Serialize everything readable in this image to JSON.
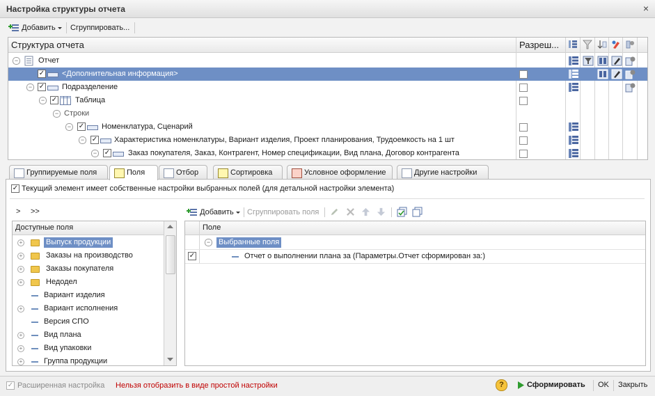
{
  "window": {
    "title": "Настройка структуры отчета",
    "close_glyph": "×"
  },
  "toolbar": {
    "add_label": "Добавить",
    "group_label": "Сгруппировать..."
  },
  "tree": {
    "col_structure": "Структура отчета",
    "col_allowed": "Разреш...",
    "rows": [
      {
        "label": "Отчет"
      },
      {
        "label": "<Дополнительная информация>"
      },
      {
        "label": "Подразделение"
      },
      {
        "label": "Таблица"
      },
      {
        "label": "Строки"
      },
      {
        "label": "Номенклатура, Сценарий"
      },
      {
        "label": "Характеристика номенклатуры, Вариант изделия, Проект планирования, Трудоемкость на 1 шт"
      },
      {
        "label": "Заказ покупателя, Заказ, Контрагент, Номер спецификации, Вид плана, Договор контрагента"
      }
    ]
  },
  "tabs": [
    {
      "label": "Группируемые поля"
    },
    {
      "label": "Поля"
    },
    {
      "label": "Отбор"
    },
    {
      "label": "Сортировка"
    },
    {
      "label": "Условное оформление"
    },
    {
      "label": "Другие настройки"
    }
  ],
  "fields_tab": {
    "own_settings_label": "Текущий элемент имеет собственные настройки выбранных полей (для детальной настройки элемента)",
    "move_one": ">",
    "move_all": ">>",
    "available_header": "Доступные поля",
    "available_items": [
      {
        "label": "Выпуск продукции",
        "icon": "folder-icon"
      },
      {
        "label": "Заказы на производство",
        "icon": "folder-icon"
      },
      {
        "label": "Заказы покупателя",
        "icon": "folder-icon"
      },
      {
        "label": "Недодел",
        "icon": "folder-icon"
      },
      {
        "label": "Вариант изделия",
        "icon": "field-icon"
      },
      {
        "label": "Вариант исполнения",
        "icon": "field-icon"
      },
      {
        "label": "Версия СПО",
        "icon": "field-icon"
      },
      {
        "label": "Вид плана",
        "icon": "field-icon"
      },
      {
        "label": "Вид упаковки",
        "icon": "field-icon"
      },
      {
        "label": "Группа продукции",
        "icon": "field-icon"
      }
    ],
    "selected_toolbar": {
      "add_label": "Добавить",
      "group_label": "Сгруппировать поля"
    },
    "selected_header": "Поле",
    "selected_group": "Выбранные поля",
    "selected_items": [
      {
        "label": "Отчет о выполнении плана за (Параметры.Отчет сформирован за:)"
      }
    ]
  },
  "status": {
    "advanced_label": "Расширенная настройка",
    "warning": "Нельзя отобразить в виде простой настройки",
    "warning_color": "#c00000",
    "run_label": "Сформировать",
    "ok_label": "OK",
    "close_label": "Закрыть",
    "help_glyph": "?"
  }
}
